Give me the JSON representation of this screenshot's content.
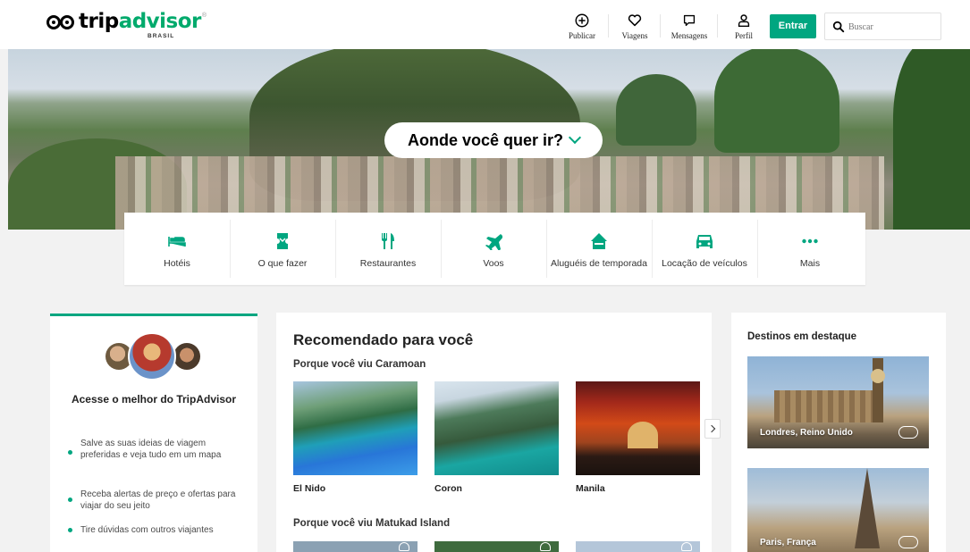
{
  "header": {
    "logo": {
      "trip": "trip",
      "advisor": "advisor",
      "reg": "®",
      "country": "BRASIL"
    },
    "nav": [
      {
        "label": "Publicar",
        "icon": "plus-circle-icon"
      },
      {
        "label": "Viagens",
        "icon": "heart-icon"
      },
      {
        "label": "Mensagens",
        "icon": "message-icon"
      },
      {
        "label": "Perfil",
        "icon": "user-icon"
      }
    ],
    "login_label": "Entrar",
    "search_placeholder": "Buscar"
  },
  "hero": {
    "question": "Aonde você quer ir?"
  },
  "categories": [
    {
      "label": "Hotéis",
      "icon": "bed-icon"
    },
    {
      "label": "O que fazer",
      "icon": "ticket-icon"
    },
    {
      "label": "Restaurantes",
      "icon": "fork-knife-icon"
    },
    {
      "label": "Voos",
      "icon": "plane-icon"
    },
    {
      "label": "Aluguéis de temporada",
      "icon": "house-icon"
    },
    {
      "label": "Locação de veículos",
      "icon": "car-icon"
    },
    {
      "label": "Mais",
      "icon": "more-dots-icon"
    }
  ],
  "signup_card": {
    "title": "Acesse o melhor do TripAdvisor",
    "benefits": [
      "Salve as suas ideias de viagem preferidas e veja tudo em um mapa",
      "Receba alertas de preço e ofertas para viajar do seu jeito",
      "Tire dúvidas com outros viajantes"
    ]
  },
  "recommended": {
    "title": "Recomendado para você",
    "section1_title": "Porque você viu Caramoan",
    "section1_items": [
      "El Nido",
      "Coron",
      "Manila"
    ],
    "section2_title": "Porque você viu Matukad Island"
  },
  "featured": {
    "title": "Destinos em destaque",
    "destinations": [
      "Londres, Reino Unido",
      "Paris, França"
    ]
  },
  "colors": {
    "brand_green": "#00a680",
    "logo_green": "#00aa6c"
  }
}
